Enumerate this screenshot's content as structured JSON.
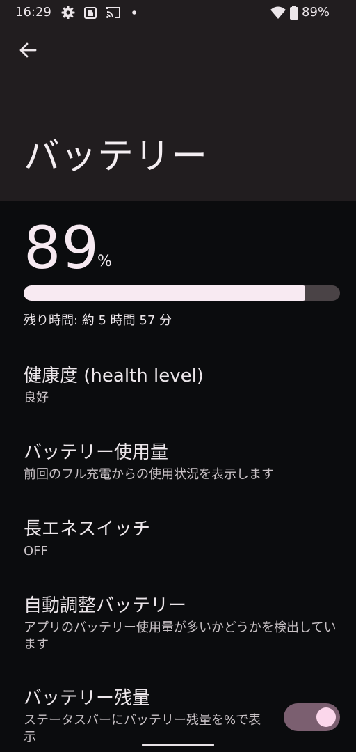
{
  "status_bar": {
    "time": "16:29",
    "battery_percent": "89%",
    "icons": [
      "gear-icon",
      "notification-app-icon",
      "cast-icon",
      "dot-icon",
      "wifi-icon",
      "battery-icon"
    ]
  },
  "header": {
    "back_icon": "arrow-left-icon",
    "title": "バッテリー"
  },
  "battery": {
    "level_value": "89",
    "level_unit": "%",
    "level_fraction": 0.89,
    "remaining": "残り時間: 約 5 時間 57 分"
  },
  "preferences": [
    {
      "title": "健康度 (health level)",
      "summary": "良好"
    },
    {
      "title": "バッテリー使用量",
      "summary": "前回のフル充電からの使用状況を表示します"
    },
    {
      "title": "長エネスイッチ",
      "summary": "OFF"
    },
    {
      "title": "自動調整バッテリー",
      "summary": "アプリのバッテリー使用量が多いかどうかを検出しています"
    },
    {
      "title": "バッテリー残量",
      "summary": "ステータスバーにバッテリー残量を%で表示",
      "toggle_on": true
    }
  ],
  "colors": {
    "header_bg": "#211d1f",
    "content_bg": "#0b0c0e",
    "meter_fill": "#f8eaf2",
    "meter_track": "#4a4346",
    "toggle_track": "#7b5f70",
    "toggle_thumb": "#fbd7eb"
  }
}
